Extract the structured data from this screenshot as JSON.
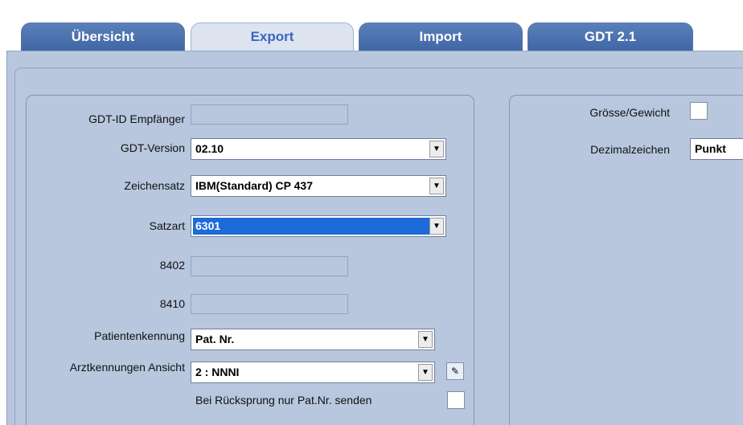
{
  "tabs": [
    {
      "label": "Übersicht",
      "active": false
    },
    {
      "label": "Export",
      "active": true
    },
    {
      "label": "Import",
      "active": false
    },
    {
      "label": "GDT 2.1",
      "active": false
    }
  ],
  "left": {
    "gdt_id_label": "GDT-ID Empfänger",
    "gdt_id_value": "",
    "gdt_version_label": "GDT-Version",
    "gdt_version_value": "02.10",
    "charset_label": "Zeichensatz",
    "charset_value": "IBM(Standard) CP 437",
    "satzart_label": "Satzart",
    "satzart_value": "6301",
    "f8402_label": "8402",
    "f8410_label": "8410",
    "patient_id_label": "Patientenkennung",
    "patient_id_value": "Pat. Nr.",
    "doctor_view_label": "Arztkennungen Ansicht",
    "doctor_view_value": "2 : NNNI",
    "return_label": "Bei Rücksprung nur Pat.Nr. senden"
  },
  "right": {
    "size_weight_label": "Grösse/Gewicht",
    "decimal_label": "Dezimalzeichen",
    "decimal_value": "Punkt"
  },
  "colors": {
    "tab_inactive": "#4a72b0",
    "tab_active": "#dde4f0",
    "panel_bg": "#b8c7de",
    "selection": "#1c6bd9"
  }
}
